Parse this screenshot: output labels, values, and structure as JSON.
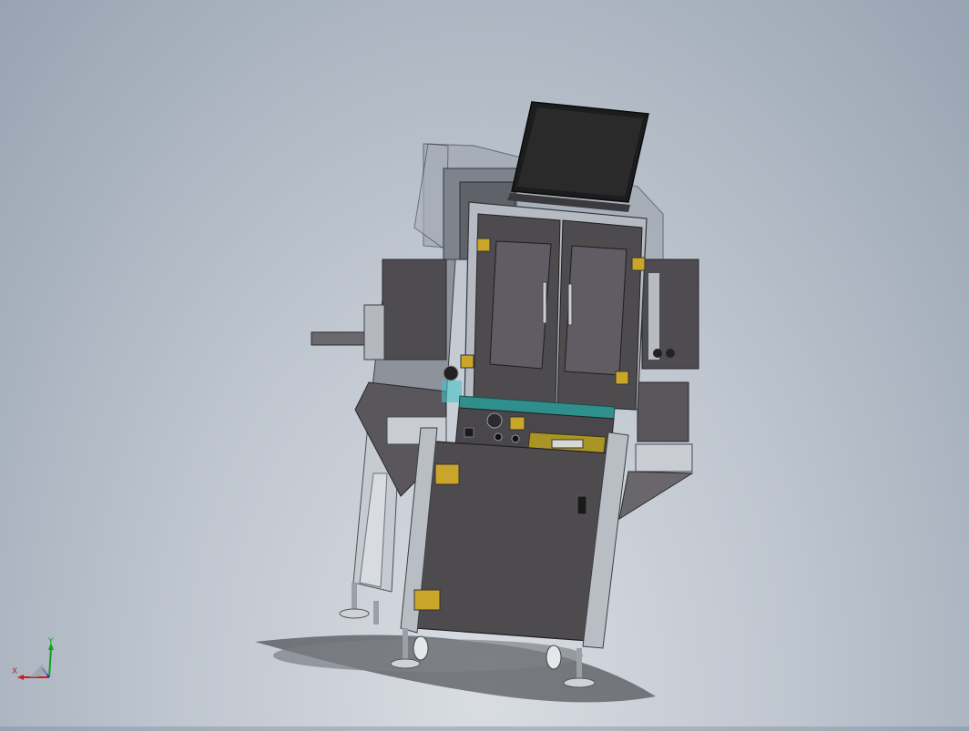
{
  "view": {
    "type": "cad-3d-viewport",
    "background_top": "#8f9cad",
    "background_bottom": "#dadee4",
    "model_colors": {
      "body": "#4e4b4f",
      "frame": "#b7bcc4",
      "trim": "#2f8f8d",
      "hinge": "#c9a62a",
      "monitor": "#1c1c1c"
    }
  },
  "triad": {
    "x_label": "X",
    "y_label": "Y",
    "x_color": "#d11a1a",
    "y_color": "#14a01a",
    "z_color": "#1a3fd1"
  }
}
